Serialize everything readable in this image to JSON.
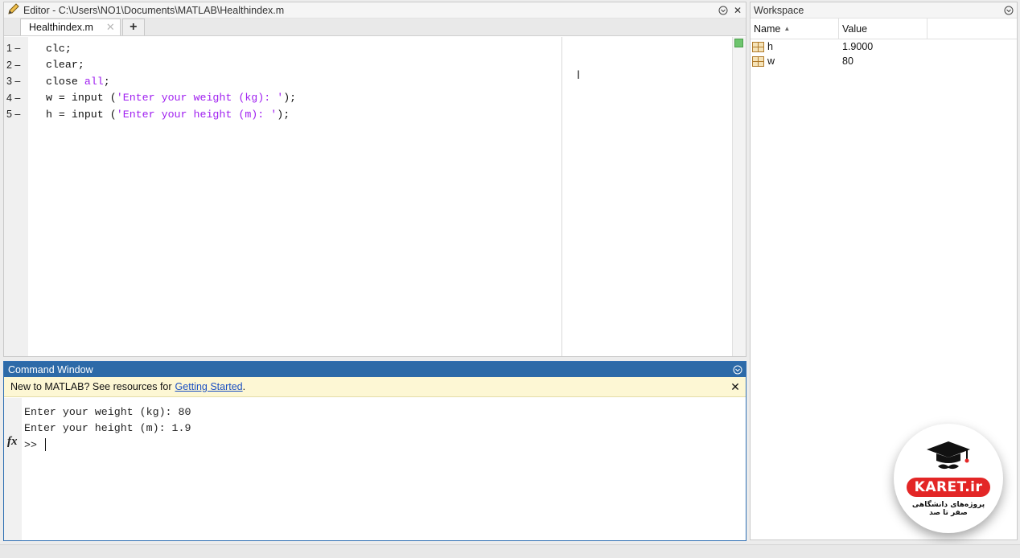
{
  "editor": {
    "title": "Editor - C:\\Users\\NO1\\Documents\\MATLAB\\Healthindex.m",
    "tab_label": "Healthindex.m",
    "lines": [
      {
        "num": "1",
        "parts": [
          {
            "t": "clc;",
            "c": "code"
          }
        ]
      },
      {
        "num": "2",
        "parts": [
          {
            "t": "clear;",
            "c": "code"
          }
        ]
      },
      {
        "num": "3",
        "parts": [
          {
            "t": "close ",
            "c": "code"
          },
          {
            "t": "all",
            "c": "kw"
          },
          {
            "t": ";",
            "c": "code"
          }
        ]
      },
      {
        "num": "4",
        "parts": [
          {
            "t": "w = input (",
            "c": "code"
          },
          {
            "t": "'Enter your weight (kg): '",
            "c": "str"
          },
          {
            "t": ");",
            "c": "code"
          }
        ]
      },
      {
        "num": "5",
        "parts": [
          {
            "t": "h = input (",
            "c": "code"
          },
          {
            "t": "'Enter your height (m): '",
            "c": "str"
          },
          {
            "t": ");",
            "c": "code"
          }
        ]
      }
    ]
  },
  "command_window": {
    "title": "Command Window",
    "notice_text": "New to MATLAB? See resources for",
    "notice_link": "Getting Started",
    "notice_period": ".",
    "output_lines": [
      "Enter your weight (kg): 80",
      "Enter your height (m): 1.9"
    ],
    "prompt": ">>",
    "fx_label": "fx"
  },
  "workspace": {
    "title": "Workspace",
    "col_name": "Name",
    "col_value": "Value",
    "variables": [
      {
        "name": "h",
        "value": "1.9000"
      },
      {
        "name": "w",
        "value": "80"
      }
    ]
  },
  "logo": {
    "brand": "KARET.ir",
    "subtitle1": "پروژه‌های دانشگاهی",
    "subtitle2": "صفر تا صد"
  },
  "colors": {
    "keyword": "#a020f0",
    "string": "#a020f0",
    "cmd_titlebar": "#2d6aa8",
    "notice_bg": "#fdf7d4",
    "logo_red": "#e32626"
  }
}
